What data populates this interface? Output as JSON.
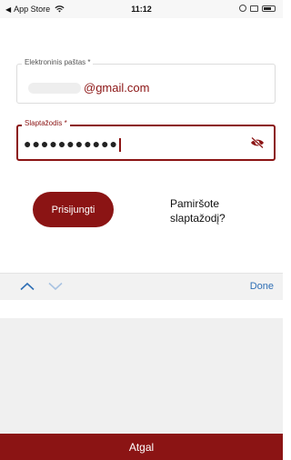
{
  "status_bar": {
    "back_app": "App Store",
    "time": "11:12",
    "icons": [
      "wifi-icon",
      "location-lock-icon",
      "screen-icon",
      "battery-icon"
    ]
  },
  "email": {
    "label": "Elektroninis paštas *",
    "value": "@gmail.com"
  },
  "password": {
    "label": "Slaptažodis *",
    "value": "●●●●●●●●●●●"
  },
  "actions": {
    "login_label": "Prisijungti",
    "forgot_line1": "Pamiršote",
    "forgot_line2": "slaptažodį?"
  },
  "keyboard_toolbar": {
    "done_label": "Done"
  },
  "footer": {
    "back_label": "Atgal"
  },
  "colors": {
    "brand": "#8b1414",
    "accent": "#2f6fb5"
  }
}
